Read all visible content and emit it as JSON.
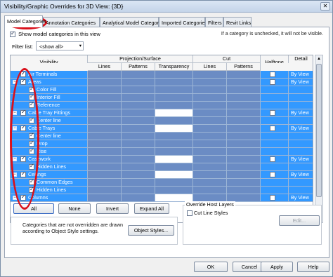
{
  "window": {
    "title": "Visibility/Graphic Overrides for 3D View: {3D}",
    "close_glyph": "✕"
  },
  "tabs": [
    {
      "label": "Model Categories",
      "active": true
    },
    {
      "label": "Annotation Categories",
      "active": false
    },
    {
      "label": "Analytical Model Categories",
      "active": false
    },
    {
      "label": "Imported Categories",
      "active": false
    },
    {
      "label": "Filters",
      "active": false
    },
    {
      "label": "Revit Links",
      "active": false
    }
  ],
  "show_model_categories": {
    "label": "Show model categories in this view",
    "checked": true
  },
  "hint": "If a category is unchecked, it will not be visible.",
  "filter": {
    "label": "Filter list:",
    "value": "<show all>",
    "arrow": "▾"
  },
  "grid": {
    "group_headers": {
      "visibility": "Visibility",
      "projection_surface": "Projection/Surface",
      "cut": "Cut",
      "halftone": "Halftone",
      "detail_level": "Detail Level"
    },
    "sub_headers": [
      "Lines",
      "Patterns",
      "Transparency",
      "Lines",
      "Patterns"
    ],
    "rows": [
      {
        "label": "Air Terminals",
        "level": 0,
        "expander": "",
        "checked": true,
        "halftone_box": true,
        "detail": "By View",
        "white_transparency": false
      },
      {
        "label": "Areas",
        "level": 0,
        "expander": "−",
        "checked": true,
        "halftone_box": true,
        "detail": "By View",
        "white_transparency": false
      },
      {
        "label": "Color Fill",
        "level": 1,
        "expander": "",
        "checked": true,
        "halftone_box": false,
        "detail": "",
        "white_transparency": false
      },
      {
        "label": "Interior Fill",
        "level": 1,
        "expander": "",
        "checked": true,
        "halftone_box": false,
        "detail": "",
        "white_transparency": false
      },
      {
        "label": "Reference",
        "level": 1,
        "expander": "",
        "checked": true,
        "halftone_box": false,
        "detail": "",
        "white_transparency": false
      },
      {
        "label": "Cable Tray Fittings",
        "level": 0,
        "expander": "−",
        "checked": true,
        "halftone_box": true,
        "detail": "By View",
        "white_transparency": true
      },
      {
        "label": "Center line",
        "level": 1,
        "expander": "",
        "checked": true,
        "halftone_box": false,
        "detail": "",
        "white_transparency": false
      },
      {
        "label": "Cable Trays",
        "level": 0,
        "expander": "−",
        "checked": true,
        "halftone_box": true,
        "detail": "By View",
        "white_transparency": true
      },
      {
        "label": "Center line",
        "level": 1,
        "expander": "",
        "checked": true,
        "halftone_box": false,
        "detail": "",
        "white_transparency": false
      },
      {
        "label": "Drop",
        "level": 1,
        "expander": "",
        "checked": true,
        "halftone_box": false,
        "detail": "",
        "white_transparency": false
      },
      {
        "label": "Rise",
        "level": 1,
        "expander": "",
        "checked": true,
        "halftone_box": false,
        "detail": "",
        "white_transparency": false
      },
      {
        "label": "Casework",
        "level": 0,
        "expander": "−",
        "checked": true,
        "halftone_box": true,
        "detail": "By View",
        "white_transparency": true
      },
      {
        "label": "Hidden Lines",
        "level": 1,
        "expander": "",
        "checked": true,
        "halftone_box": false,
        "detail": "",
        "white_transparency": false
      },
      {
        "label": "Ceilings",
        "level": 0,
        "expander": "−",
        "checked": true,
        "halftone_box": true,
        "detail": "By View",
        "white_transparency": true
      },
      {
        "label": "Common Edges",
        "level": 1,
        "expander": "",
        "checked": true,
        "halftone_box": false,
        "detail": "",
        "white_transparency": false
      },
      {
        "label": "Hidden Lines",
        "level": 1,
        "expander": "",
        "checked": true,
        "halftone_box": false,
        "detail": "",
        "white_transparency": false
      },
      {
        "label": "Columns",
        "level": 0,
        "expander": "−",
        "checked": true,
        "halftone_box": true,
        "detail": "By View",
        "white_transparency": true
      }
    ]
  },
  "scrollbar": {
    "up": "▲",
    "down": "▼"
  },
  "buttons": {
    "all": "All",
    "none": "None",
    "invert": "Invert",
    "expand_all": "Expand All",
    "object_styles": "Object Styles...",
    "edit": "Edit...",
    "ok": "OK",
    "cancel": "Cancel",
    "apply": "Apply",
    "help": "Help"
  },
  "override_host": {
    "title": "Override Host Layers",
    "cut_line_styles": "Cut Line Styles",
    "checked": false
  },
  "note": "Categories that are not overridden are drawn according to Object Style settings.",
  "colors": {
    "selection": "#3399ff",
    "override_cell": "#6b8cc4",
    "annotation_ring": "#d9101a"
  }
}
